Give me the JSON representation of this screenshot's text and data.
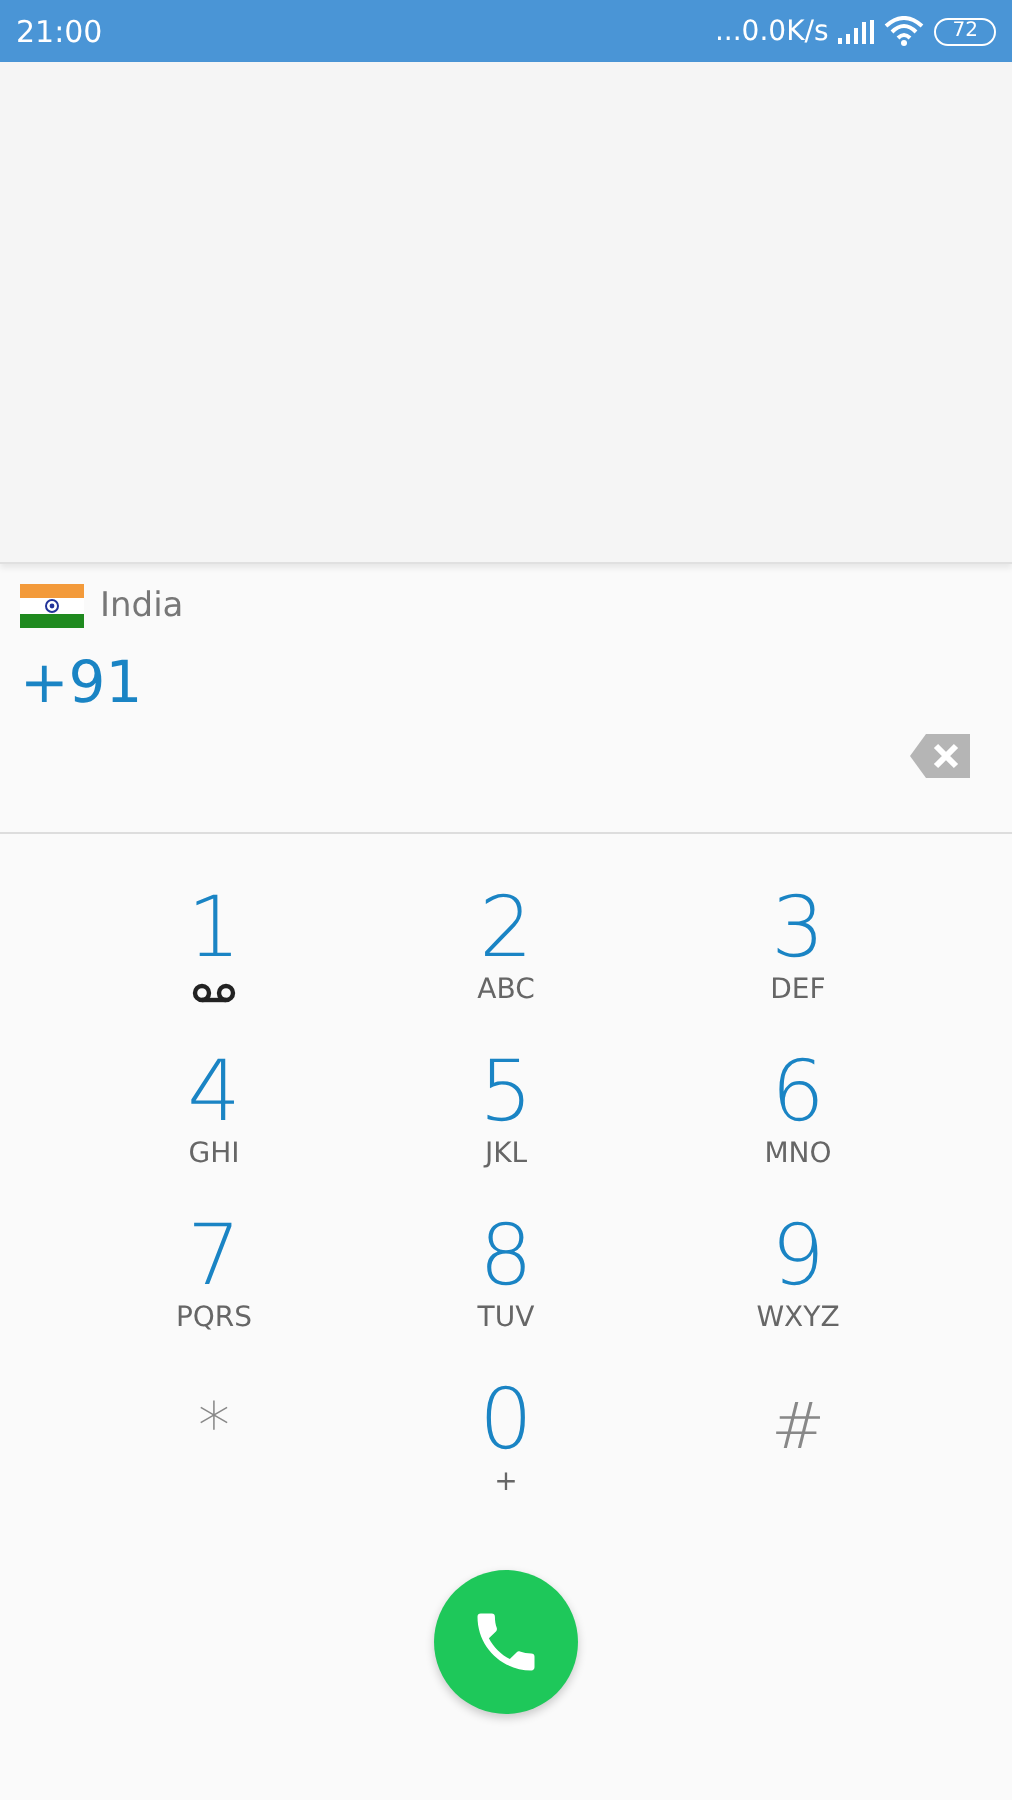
{
  "status_bar": {
    "time": "21:00",
    "network_speed": "...0.0K/s",
    "battery": "72"
  },
  "country": {
    "name": "India"
  },
  "number": {
    "value": "+91"
  },
  "keys": [
    {
      "kind": "voicemail",
      "main": "1"
    },
    {
      "kind": "digit",
      "main": "2",
      "sub": "ABC"
    },
    {
      "kind": "digit",
      "main": "3",
      "sub": "DEF"
    },
    {
      "kind": "digit",
      "main": "4",
      "sub": "GHI"
    },
    {
      "kind": "digit",
      "main": "5",
      "sub": "JKL"
    },
    {
      "kind": "digit",
      "main": "6",
      "sub": "MNO"
    },
    {
      "kind": "digit",
      "main": "7",
      "sub": "PQRS"
    },
    {
      "kind": "digit",
      "main": "8",
      "sub": "TUV"
    },
    {
      "kind": "digit",
      "main": "9",
      "sub": "WXYZ"
    },
    {
      "kind": "symbol",
      "main": "*"
    },
    {
      "kind": "digit",
      "main": "0",
      "sub": "+"
    },
    {
      "kind": "symbol",
      "main": "#"
    }
  ]
}
